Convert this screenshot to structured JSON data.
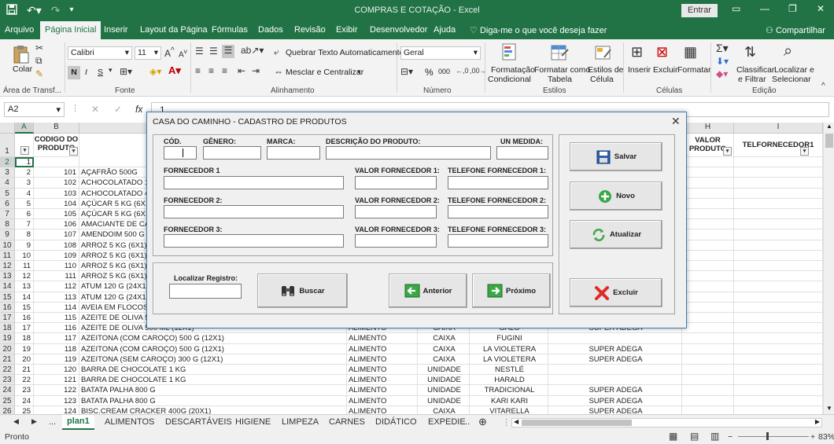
{
  "titlebar": {
    "title": "COMPRAS E COTAÇÃO  -  Excel",
    "signin": "Entrar"
  },
  "menu": {
    "tabs": [
      "Arquivo",
      "Página Inicial",
      "Inserir",
      "Layout da Página",
      "Fórmulas",
      "Dados",
      "Revisão",
      "Exibir",
      "Desenvolvedor",
      "Ajuda"
    ],
    "tell_me": "Diga-me o que você deseja fazer",
    "share": "Compartilhar"
  },
  "ribbon": {
    "paste": "Colar",
    "clipboard_group": "Área de Transf...",
    "font_name": "Calibri",
    "font_size": "11",
    "bold": "N",
    "italic": "I",
    "underline": "S",
    "font_group": "Fonte",
    "wrap_text": "Quebrar Texto Automaticamente",
    "merge_center": "Mesclar e Centralizar",
    "alignment_group": "Alinhamento",
    "number_format": "Geral",
    "percent": "%",
    "thousands": "000",
    "number_group": "Número",
    "cond_format": [
      "Formatação",
      "Condicional"
    ],
    "format_table": [
      "Formatar como",
      "Tabela"
    ],
    "cell_styles": [
      "Estilos de",
      "Célula"
    ],
    "styles_group": "Estilos",
    "insert": "Inserir",
    "delete": "Excluir",
    "format": "Formatar",
    "cells_group": "Células",
    "sort_filter": [
      "Classificar",
      "e Filtrar"
    ],
    "find_select": [
      "Localizar e",
      "Selecionar"
    ],
    "edit_group": "Edição"
  },
  "formula_bar": {
    "name_box": "A2",
    "fx": "fx",
    "value": "1"
  },
  "grid": {
    "col_headers": [
      "A",
      "B",
      "",
      "",
      "",
      "",
      "",
      "H",
      "I"
    ],
    "header_row": {
      "codigo": "CODIGO DO PRODUTO",
      "valor": "VALOR PRODUTO",
      "telefone": "TELFORNECEDOR1"
    },
    "rows": [
      {
        "n": "2",
        "a": "1",
        "b": "",
        "c": "",
        "d": "",
        "e": "",
        "f": "",
        "g": ""
      },
      {
        "n": "3",
        "a": "2",
        "b": "101",
        "c": "AÇAFRÃO 500G",
        "d": "",
        "e": "",
        "f": "",
        "g": ""
      },
      {
        "n": "4",
        "a": "3",
        "b": "102",
        "c": "ACHOCOLATADO 1,20",
        "d": "",
        "e": "",
        "f": "",
        "g": ""
      },
      {
        "n": "5",
        "a": "4",
        "b": "103",
        "c": "ACHOCOLATADO 400G",
        "d": "",
        "e": "",
        "f": "",
        "g": ""
      },
      {
        "n": "6",
        "a": "5",
        "b": "104",
        "c": "AÇÚCAR 5 KG (6X1)",
        "d": "",
        "e": "",
        "f": "",
        "g": ""
      },
      {
        "n": "7",
        "a": "6",
        "b": "105",
        "c": "AÇÚCAR 5 KG (6X1)",
        "d": "",
        "e": "",
        "f": "",
        "g": ""
      },
      {
        "n": "8",
        "a": "7",
        "b": "106",
        "c": "AMACIANTE DE CARN",
        "d": "",
        "e": "",
        "f": "",
        "g": ""
      },
      {
        "n": "9",
        "a": "8",
        "b": "107",
        "c": "AMENDOIM 500 G (1",
        "d": "",
        "e": "",
        "f": "",
        "g": ""
      },
      {
        "n": "10",
        "a": "9",
        "b": "108",
        "c": "ARROZ 5 KG (6X1)",
        "d": "",
        "e": "",
        "f": "",
        "g": ""
      },
      {
        "n": "11",
        "a": "10",
        "b": "109",
        "c": "ARROZ 5 KG (6X1)",
        "d": "",
        "e": "",
        "f": "",
        "g": ""
      },
      {
        "n": "12",
        "a": "11",
        "b": "110",
        "c": "ARROZ 5 KG (6X1)",
        "d": "",
        "e": "",
        "f": "",
        "g": ""
      },
      {
        "n": "13",
        "a": "12",
        "b": "111",
        "c": "ARROZ 5 KG (6X1)",
        "d": "",
        "e": "",
        "f": "",
        "g": ""
      },
      {
        "n": "14",
        "a": "13",
        "b": "112",
        "c": "ATUM 120 G (24X1)",
        "d": "",
        "e": "",
        "f": "",
        "g": ""
      },
      {
        "n": "15",
        "a": "14",
        "b": "113",
        "c": "ATUM 120 G (24X1)",
        "d": "",
        "e": "",
        "f": "",
        "g": ""
      },
      {
        "n": "16",
        "a": "15",
        "b": "114",
        "c": "AVEIA EM FLOCOS 25",
        "d": "",
        "e": "",
        "f": "",
        "g": ""
      },
      {
        "n": "17",
        "a": "16",
        "b": "115",
        "c": "AZEITE DE OLIVA 50",
        "d": "",
        "e": "",
        "f": "",
        "g": ""
      },
      {
        "n": "18",
        "a": "17",
        "b": "116",
        "c": "AZEITE DE OLIVA 500 ML (12X1)",
        "d": "ALIMENTO",
        "e": "CAIXA",
        "f": "GALO",
        "g": "SUPER ADEGA"
      },
      {
        "n": "19",
        "a": "18",
        "b": "117",
        "c": "AZEITONA (COM CAROÇO) 500 G (12X1)",
        "d": "ALIMENTO",
        "e": "CAIXA",
        "f": "FUGINI",
        "g": ""
      },
      {
        "n": "20",
        "a": "19",
        "b": "118",
        "c": "AZEITONA (COM CAROÇO) 500 G (12X1)",
        "d": "ALIMENTO",
        "e": "CAIXA",
        "f": "LA VIOLETERA",
        "g": "SUPER ADEGA"
      },
      {
        "n": "21",
        "a": "20",
        "b": "119",
        "c": "AZEITONA (SEM CAROÇO) 300 G (12X1)",
        "d": "ALIMENTO",
        "e": "CAIXA",
        "f": "LA VIOLETERA",
        "g": "SUPER ADEGA"
      },
      {
        "n": "22",
        "a": "21",
        "b": "120",
        "c": "BARRA DE CHOCOLATE 1 KG",
        "d": "ALIMENTO",
        "e": "UNIDADE",
        "f": "NESTLÉ",
        "g": ""
      },
      {
        "n": "23",
        "a": "22",
        "b": "121",
        "c": "BARRA DE CHOCOLATE 1 KG",
        "d": "ALIMENTO",
        "e": "UNIDADE",
        "f": "HARALD",
        "g": ""
      },
      {
        "n": "24",
        "a": "23",
        "b": "122",
        "c": "BATATA PALHA  800 G",
        "d": "ALIMENTO",
        "e": "UNIDADE",
        "f": "TRADICIONAL",
        "g": "SUPER ADEGA"
      },
      {
        "n": "25",
        "a": "24",
        "b": "123",
        "c": "BATATA PALHA  800 G",
        "d": "ALIMENTO",
        "e": "UNIDADE",
        "f": "KARI KARI",
        "g": "SUPER ADEGA"
      },
      {
        "n": "26",
        "a": "25",
        "b": "124",
        "c": "BISC.CREAM CRACKER 400G (20X1)",
        "d": "ALIMENTO",
        "e": "CAIXA",
        "f": "VITARELLA",
        "g": "SUPER ADEGA"
      }
    ]
  },
  "sheets": {
    "ellipsis": "...",
    "tabs": [
      "plan1",
      "ALIMENTOS",
      "DESCARTÁVEIS",
      "HIGIENE",
      "LIMPEZA",
      "CARNES",
      "DIDÁTICO",
      "EXPEDIE"
    ],
    "more": "..."
  },
  "status": {
    "ready": "Pronto",
    "zoom": "83%"
  },
  "dialog": {
    "title": "CASA DO CAMINHO - CADASTRO DE PRODUTOS",
    "close": "✕",
    "labels": {
      "cod": "CÓD.",
      "genero": "GÊNERO:",
      "marca": "MARCA:",
      "descricao": "DESCRIÇÃO DO PRODUTO:",
      "un_medida": "UN MEDIDA:",
      "fornecedor1": "FORNECEDOR 1",
      "valor1": "VALOR FORNECEDOR 1:",
      "telefone1": "TELEFONE FORNECEDOR 1:",
      "fornecedor2": "FORNECEDOR 2:",
      "valor2": "VALOR FORNECEDOR 2:",
      "telefone2": "TELEFONE  FORNECEDOR 2:",
      "fornecedor3": "FORNECEDOR 3:",
      "valor3": "VALOR FORNECEDOR 3:",
      "telefone3": "TELEFONE FORNECEDOR 3:",
      "localizar": "Localizar Registro:"
    },
    "buttons": {
      "salvar": "Salvar",
      "novo": "Novo",
      "atualizar": "Atualizar",
      "excluir": "Excluir",
      "buscar": "Buscar",
      "anterior": "Anterior",
      "proximo": "Próximo"
    }
  },
  "colors": {
    "excel_green": "#217346",
    "dialog_border": "#3c7fb1"
  }
}
